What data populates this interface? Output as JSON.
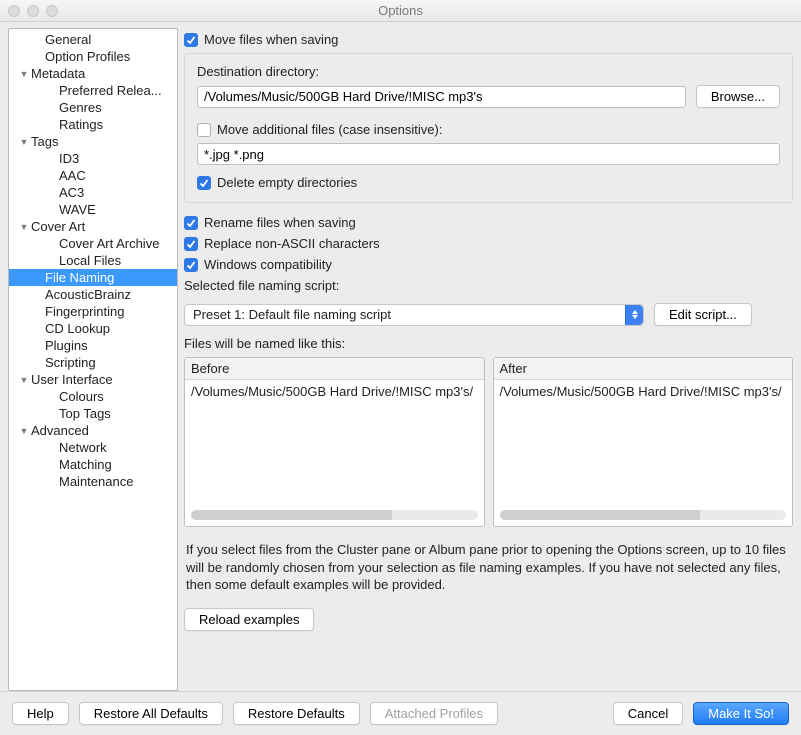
{
  "window": {
    "title": "Options"
  },
  "sidebar": {
    "items": [
      {
        "label": "General",
        "indent": 24,
        "disclose": ""
      },
      {
        "label": "Option Profiles",
        "indent": 24,
        "disclose": ""
      },
      {
        "label": "Metadata",
        "indent": 10,
        "disclose": "▼"
      },
      {
        "label": "Preferred Relea...",
        "indent": 38,
        "disclose": ""
      },
      {
        "label": "Genres",
        "indent": 38,
        "disclose": ""
      },
      {
        "label": "Ratings",
        "indent": 38,
        "disclose": ""
      },
      {
        "label": "Tags",
        "indent": 10,
        "disclose": "▼"
      },
      {
        "label": "ID3",
        "indent": 38,
        "disclose": ""
      },
      {
        "label": "AAC",
        "indent": 38,
        "disclose": ""
      },
      {
        "label": "AC3",
        "indent": 38,
        "disclose": ""
      },
      {
        "label": "WAVE",
        "indent": 38,
        "disclose": ""
      },
      {
        "label": "Cover Art",
        "indent": 10,
        "disclose": "▼"
      },
      {
        "label": "Cover Art Archive",
        "indent": 38,
        "disclose": ""
      },
      {
        "label": "Local Files",
        "indent": 38,
        "disclose": ""
      },
      {
        "label": "File Naming",
        "indent": 24,
        "disclose": "",
        "selected": true
      },
      {
        "label": "AcousticBrainz",
        "indent": 24,
        "disclose": ""
      },
      {
        "label": "Fingerprinting",
        "indent": 24,
        "disclose": ""
      },
      {
        "label": "CD Lookup",
        "indent": 24,
        "disclose": ""
      },
      {
        "label": "Plugins",
        "indent": 24,
        "disclose": ""
      },
      {
        "label": "Scripting",
        "indent": 24,
        "disclose": ""
      },
      {
        "label": "User Interface",
        "indent": 10,
        "disclose": "▼"
      },
      {
        "label": "Colours",
        "indent": 38,
        "disclose": ""
      },
      {
        "label": "Top Tags",
        "indent": 38,
        "disclose": ""
      },
      {
        "label": "Advanced",
        "indent": 10,
        "disclose": "▼"
      },
      {
        "label": "Network",
        "indent": 38,
        "disclose": ""
      },
      {
        "label": "Matching",
        "indent": 38,
        "disclose": ""
      },
      {
        "label": "Maintenance",
        "indent": 38,
        "disclose": ""
      }
    ]
  },
  "panel": {
    "move_files": {
      "checked": true,
      "label": "Move files when saving"
    },
    "dest_label": "Destination directory:",
    "dest_value": "/Volumes/Music/500GB Hard Drive/!MISC mp3's",
    "browse_label": "Browse...",
    "move_additional": {
      "checked": false,
      "label": "Move additional files (case insensitive):"
    },
    "additional_value": "*.jpg *.png",
    "delete_empty": {
      "checked": true,
      "label": "Delete empty directories"
    },
    "rename_files": {
      "checked": true,
      "label": "Rename files when saving"
    },
    "replace_nonascii": {
      "checked": true,
      "label": "Replace non-ASCII characters"
    },
    "windows_compat": {
      "checked": true,
      "label": "Windows compatibility"
    },
    "script_label": "Selected file naming script:",
    "script_preset": "Preset 1: Default file naming script",
    "edit_script_label": "Edit script...",
    "preview_label": "Files will be named like this:",
    "before_header": "Before",
    "after_header": "After",
    "before_value": "/Volumes/Music/500GB Hard Drive/!MISC mp3's/",
    "after_value": "/Volumes/Music/500GB Hard Drive/!MISC mp3's/",
    "help_text": "If you select files from the Cluster pane or Album pane prior to opening the Options screen, up to 10 files will be randomly chosen from your selection as file naming examples.  If you have not selected any files, then some default examples will be provided.",
    "reload_label": "Reload examples"
  },
  "footer": {
    "help": "Help",
    "restore_all": "Restore All Defaults",
    "restore": "Restore Defaults",
    "attached": "Attached Profiles",
    "cancel": "Cancel",
    "ok": "Make It So!"
  }
}
